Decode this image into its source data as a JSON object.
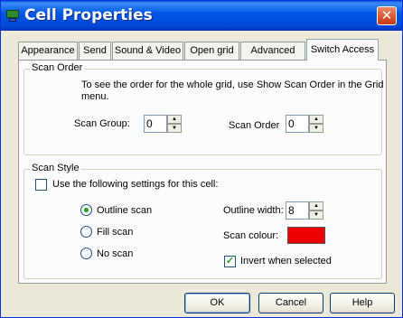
{
  "window": {
    "title": "Cell Properties",
    "close_icon": "close-icon",
    "app_icon": "app-icon"
  },
  "tabs": [
    {
      "label": "Appearance",
      "active": false
    },
    {
      "label": "Send",
      "active": false
    },
    {
      "label": "Sound & Video",
      "active": false
    },
    {
      "label": "Open grid",
      "active": false
    },
    {
      "label": "Advanced",
      "active": false
    },
    {
      "label": "Switch Access",
      "active": true
    }
  ],
  "scan_order": {
    "title": "Scan Order",
    "info": "To see the order for the whole grid, use Show Scan Order in the Grid",
    "info2": "menu.",
    "group_label": "Scan Group:",
    "group_value": "0",
    "order_label": "Scan Order",
    "order_value": "0"
  },
  "scan_style": {
    "title": "Scan Style",
    "use_settings_label": "Use the following settings for this cell:",
    "use_settings_checked": false,
    "options": [
      {
        "label": "Outline scan",
        "selected": true
      },
      {
        "label": "Fill scan",
        "selected": false
      },
      {
        "label": "No scan",
        "selected": false
      }
    ],
    "outline_width_label": "Outline width:",
    "outline_width_value": "8",
    "scan_colour_label": "Scan colour:",
    "scan_colour": "#ee0000",
    "invert_label": "Invert when selected",
    "invert_checked": true
  },
  "buttons": {
    "ok": "OK",
    "cancel": "Cancel",
    "help": "Help"
  },
  "colors": {
    "titlebar": "#0058e8",
    "dialog_bg": "#ece9d8",
    "check_mark": "#21a121"
  }
}
